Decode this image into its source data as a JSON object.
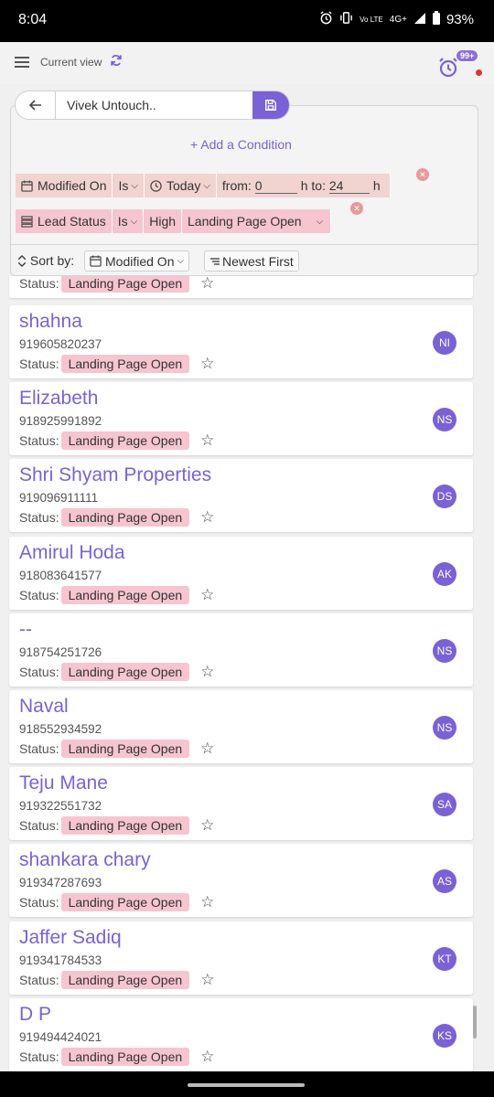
{
  "statusbar": {
    "time": "8:04",
    "network": "4G+",
    "network_sub": "Vo LTE",
    "battery": "93%"
  },
  "header": {
    "view_label": "Current view",
    "alarm_badge": "99+"
  },
  "search": {
    "value": "Vivek Untouch.."
  },
  "add_condition": "+ Add a Condition",
  "conditions": {
    "row1": {
      "field": "Modified On",
      "op": "Is",
      "value": "Today",
      "from_label": "from:",
      "from_value": "0",
      "h1": "h",
      "to_label": "to:",
      "to_value": "24",
      "h2": "h"
    },
    "row2": {
      "field": "Lead Status",
      "op": "Is",
      "value1": "High",
      "value2": "Landing Page Open"
    }
  },
  "sort": {
    "label": "Sort by:",
    "field": "Modified On",
    "order": "Newest First"
  },
  "status_label": "Status:",
  "partial_status": "Landing Page Open",
  "leads": [
    {
      "name": "shahna",
      "phone": "919605820237",
      "status": "Landing Page Open",
      "initials": "NI"
    },
    {
      "name": "Elizabeth",
      "phone": "918925991892",
      "status": "Landing Page Open",
      "initials": "NS"
    },
    {
      "name": "Shri Shyam Properties",
      "phone": "919096911111",
      "status": "Landing Page Open",
      "initials": "DS"
    },
    {
      "name": "Amirul Hoda",
      "phone": "918083641577",
      "status": "Landing Page Open",
      "initials": "AK"
    },
    {
      "name": "--",
      "phone": "918754251726",
      "status": "Landing Page Open",
      "initials": "NS"
    },
    {
      "name": "Naval",
      "phone": "918552934592",
      "status": "Landing Page Open",
      "initials": "NS"
    },
    {
      "name": "Teju Mane",
      "phone": "919322551732",
      "status": "Landing Page Open",
      "initials": "SA"
    },
    {
      "name": "shankara chary",
      "phone": "919347287693",
      "status": "Landing Page Open",
      "initials": "AS"
    },
    {
      "name": "Jaffer Sadiq",
      "phone": "919341784533",
      "status": "Landing Page Open",
      "initials": "KT"
    },
    {
      "name": "D P",
      "phone": "919494424021",
      "status": "Landing Page Open",
      "initials": "KS"
    }
  ],
  "colors": {
    "accent": "#7b61d6",
    "pill": "#f6c5d0",
    "chip": "#f1d3cf"
  }
}
